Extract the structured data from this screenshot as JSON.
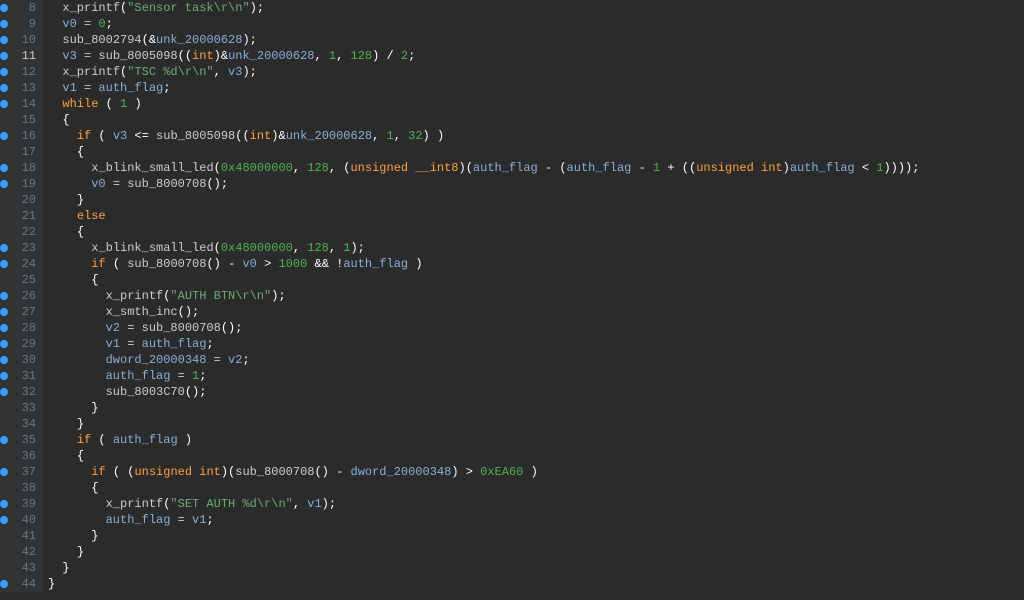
{
  "lines": [
    {
      "n": 8,
      "bp": true,
      "indent": 2,
      "tokens": [
        [
          "func",
          "x_printf"
        ],
        [
          "punc",
          "("
        ],
        [
          "string",
          "\"Sensor task\\r\\n\""
        ],
        [
          "punc",
          ");"
        ]
      ]
    },
    {
      "n": 9,
      "bp": true,
      "indent": 2,
      "tokens": [
        [
          "ident",
          "v0"
        ],
        [
          "default",
          " "
        ],
        [
          "assign",
          "="
        ],
        [
          "default",
          " "
        ],
        [
          "num",
          "0"
        ],
        [
          "punc",
          ";"
        ]
      ]
    },
    {
      "n": 10,
      "bp": true,
      "indent": 2,
      "tokens": [
        [
          "func",
          "sub_8002794"
        ],
        [
          "punc",
          "(&"
        ],
        [
          "ident",
          "unk_20000628"
        ],
        [
          "punc",
          ");"
        ]
      ]
    },
    {
      "n": 11,
      "bp": true,
      "cur": true,
      "indent": 2,
      "tokens": [
        [
          "ident",
          "v3"
        ],
        [
          "default",
          " "
        ],
        [
          "assign",
          "="
        ],
        [
          "default",
          " "
        ],
        [
          "func",
          "sub_8005098"
        ],
        [
          "punc",
          "(("
        ],
        [
          "type",
          "int"
        ],
        [
          "punc",
          ")&"
        ],
        [
          "ident",
          "unk_20000628"
        ],
        [
          "punc",
          ","
        ],
        [
          "default",
          " "
        ],
        [
          "num",
          "1"
        ],
        [
          "punc",
          ","
        ],
        [
          "default",
          " "
        ],
        [
          "num",
          "128"
        ],
        [
          "punc",
          ")"
        ],
        [
          "default",
          " "
        ],
        [
          "punc",
          "/"
        ],
        [
          "default",
          " "
        ],
        [
          "num",
          "2"
        ],
        [
          "punc",
          ";"
        ]
      ]
    },
    {
      "n": 12,
      "bp": true,
      "indent": 2,
      "tokens": [
        [
          "func",
          "x_printf"
        ],
        [
          "punc",
          "("
        ],
        [
          "string",
          "\"TSC %d\\r\\n\""
        ],
        [
          "punc",
          ","
        ],
        [
          "default",
          " "
        ],
        [
          "ident",
          "v3"
        ],
        [
          "punc",
          ");"
        ]
      ]
    },
    {
      "n": 13,
      "bp": true,
      "indent": 2,
      "tokens": [
        [
          "ident",
          "v1"
        ],
        [
          "default",
          " "
        ],
        [
          "assign",
          "="
        ],
        [
          "default",
          " "
        ],
        [
          "ident",
          "auth_flag"
        ],
        [
          "punc",
          ";"
        ]
      ]
    },
    {
      "n": 14,
      "bp": true,
      "indent": 2,
      "tokens": [
        [
          "keyword",
          "while"
        ],
        [
          "default",
          " "
        ],
        [
          "punc",
          "("
        ],
        [
          "default",
          " "
        ],
        [
          "num",
          "1"
        ],
        [
          "default",
          " "
        ],
        [
          "punc",
          ")"
        ]
      ]
    },
    {
      "n": 15,
      "bp": false,
      "indent": 2,
      "tokens": [
        [
          "punc",
          "{"
        ]
      ]
    },
    {
      "n": 16,
      "bp": true,
      "indent": 4,
      "tokens": [
        [
          "keyword",
          "if"
        ],
        [
          "default",
          " "
        ],
        [
          "punc",
          "("
        ],
        [
          "default",
          " "
        ],
        [
          "ident",
          "v3"
        ],
        [
          "default",
          " "
        ],
        [
          "punc",
          "<="
        ],
        [
          "default",
          " "
        ],
        [
          "func",
          "sub_8005098"
        ],
        [
          "punc",
          "(("
        ],
        [
          "type",
          "int"
        ],
        [
          "punc",
          ")&"
        ],
        [
          "ident",
          "unk_20000628"
        ],
        [
          "punc",
          ","
        ],
        [
          "default",
          " "
        ],
        [
          "num",
          "1"
        ],
        [
          "punc",
          ","
        ],
        [
          "default",
          " "
        ],
        [
          "num",
          "32"
        ],
        [
          "punc",
          ")"
        ],
        [
          "default",
          " "
        ],
        [
          "punc",
          ")"
        ]
      ]
    },
    {
      "n": 17,
      "bp": false,
      "indent": 4,
      "tokens": [
        [
          "punc",
          "{"
        ]
      ]
    },
    {
      "n": 18,
      "bp": true,
      "indent": 6,
      "tokens": [
        [
          "func",
          "x_blink_small_led"
        ],
        [
          "punc",
          "("
        ],
        [
          "num",
          "0x48000000"
        ],
        [
          "punc",
          ","
        ],
        [
          "default",
          " "
        ],
        [
          "num",
          "128"
        ],
        [
          "punc",
          ","
        ],
        [
          "default",
          " "
        ],
        [
          "punc",
          "("
        ],
        [
          "type",
          "unsigned __int8"
        ],
        [
          "punc",
          ")("
        ],
        [
          "ident",
          "auth_flag"
        ],
        [
          "default",
          " "
        ],
        [
          "punc",
          "-"
        ],
        [
          "default",
          " "
        ],
        [
          "punc",
          "("
        ],
        [
          "ident",
          "auth_flag"
        ],
        [
          "default",
          " "
        ],
        [
          "punc",
          "-"
        ],
        [
          "default",
          " "
        ],
        [
          "num",
          "1"
        ],
        [
          "default",
          " "
        ],
        [
          "punc",
          "+"
        ],
        [
          "default",
          " "
        ],
        [
          "punc",
          "(("
        ],
        [
          "type",
          "unsigned int"
        ],
        [
          "punc",
          ")"
        ],
        [
          "ident",
          "auth_flag"
        ],
        [
          "default",
          " "
        ],
        [
          "punc",
          "<"
        ],
        [
          "default",
          " "
        ],
        [
          "num",
          "1"
        ],
        [
          "punc",
          "))));"
        ]
      ]
    },
    {
      "n": 19,
      "bp": true,
      "indent": 6,
      "tokens": [
        [
          "ident",
          "v0"
        ],
        [
          "default",
          " "
        ],
        [
          "assign",
          "="
        ],
        [
          "default",
          " "
        ],
        [
          "func",
          "sub_8000708"
        ],
        [
          "punc",
          "();"
        ]
      ]
    },
    {
      "n": 20,
      "bp": false,
      "indent": 4,
      "tokens": [
        [
          "punc",
          "}"
        ]
      ]
    },
    {
      "n": 21,
      "bp": false,
      "indent": 4,
      "tokens": [
        [
          "keyword",
          "else"
        ]
      ]
    },
    {
      "n": 22,
      "bp": false,
      "indent": 4,
      "tokens": [
        [
          "punc",
          "{"
        ]
      ]
    },
    {
      "n": 23,
      "bp": true,
      "indent": 6,
      "tokens": [
        [
          "func",
          "x_blink_small_led"
        ],
        [
          "punc",
          "("
        ],
        [
          "num",
          "0x48000000"
        ],
        [
          "punc",
          ","
        ],
        [
          "default",
          " "
        ],
        [
          "num",
          "128"
        ],
        [
          "punc",
          ","
        ],
        [
          "default",
          " "
        ],
        [
          "num",
          "1"
        ],
        [
          "punc",
          ");"
        ]
      ]
    },
    {
      "n": 24,
      "bp": true,
      "indent": 6,
      "tokens": [
        [
          "keyword",
          "if"
        ],
        [
          "default",
          " "
        ],
        [
          "punc",
          "("
        ],
        [
          "default",
          " "
        ],
        [
          "func",
          "sub_8000708"
        ],
        [
          "punc",
          "()"
        ],
        [
          "default",
          " "
        ],
        [
          "punc",
          "-"
        ],
        [
          "default",
          " "
        ],
        [
          "ident",
          "v0"
        ],
        [
          "default",
          " "
        ],
        [
          "punc",
          ">"
        ],
        [
          "default",
          " "
        ],
        [
          "num",
          "1000"
        ],
        [
          "default",
          " "
        ],
        [
          "punc",
          "&&"
        ],
        [
          "default",
          " "
        ],
        [
          "punc",
          "!"
        ],
        [
          "ident",
          "auth_flag"
        ],
        [
          "default",
          " "
        ],
        [
          "punc",
          ")"
        ]
      ]
    },
    {
      "n": 25,
      "bp": false,
      "indent": 6,
      "tokens": [
        [
          "punc",
          "{"
        ]
      ]
    },
    {
      "n": 26,
      "bp": true,
      "indent": 8,
      "tokens": [
        [
          "func",
          "x_printf"
        ],
        [
          "punc",
          "("
        ],
        [
          "string",
          "\"AUTH BTN\\r\\n\""
        ],
        [
          "punc",
          ");"
        ]
      ]
    },
    {
      "n": 27,
      "bp": true,
      "indent": 8,
      "tokens": [
        [
          "func",
          "x_smth_inc"
        ],
        [
          "punc",
          "();"
        ]
      ]
    },
    {
      "n": 28,
      "bp": true,
      "indent": 8,
      "tokens": [
        [
          "ident",
          "v2"
        ],
        [
          "default",
          " "
        ],
        [
          "assign",
          "="
        ],
        [
          "default",
          " "
        ],
        [
          "func",
          "sub_8000708"
        ],
        [
          "punc",
          "();"
        ]
      ]
    },
    {
      "n": 29,
      "bp": true,
      "indent": 8,
      "tokens": [
        [
          "ident",
          "v1"
        ],
        [
          "default",
          " "
        ],
        [
          "assign",
          "="
        ],
        [
          "default",
          " "
        ],
        [
          "ident",
          "auth_flag"
        ],
        [
          "punc",
          ";"
        ]
      ]
    },
    {
      "n": 30,
      "bp": true,
      "indent": 8,
      "tokens": [
        [
          "ident",
          "dword_20000348"
        ],
        [
          "default",
          " "
        ],
        [
          "assign",
          "="
        ],
        [
          "default",
          " "
        ],
        [
          "ident",
          "v2"
        ],
        [
          "punc",
          ";"
        ]
      ]
    },
    {
      "n": 31,
      "bp": true,
      "indent": 8,
      "tokens": [
        [
          "ident",
          "auth_flag"
        ],
        [
          "default",
          " "
        ],
        [
          "assign",
          "="
        ],
        [
          "default",
          " "
        ],
        [
          "num",
          "1"
        ],
        [
          "punc",
          ";"
        ]
      ]
    },
    {
      "n": 32,
      "bp": true,
      "indent": 8,
      "tokens": [
        [
          "func",
          "sub_8003C70"
        ],
        [
          "punc",
          "();"
        ]
      ]
    },
    {
      "n": 33,
      "bp": false,
      "indent": 6,
      "tokens": [
        [
          "punc",
          "}"
        ]
      ]
    },
    {
      "n": 34,
      "bp": false,
      "indent": 4,
      "tokens": [
        [
          "punc",
          "}"
        ]
      ]
    },
    {
      "n": 35,
      "bp": true,
      "indent": 4,
      "tokens": [
        [
          "keyword",
          "if"
        ],
        [
          "default",
          " "
        ],
        [
          "punc",
          "("
        ],
        [
          "default",
          " "
        ],
        [
          "ident",
          "auth_flag"
        ],
        [
          "default",
          " "
        ],
        [
          "punc",
          ")"
        ]
      ]
    },
    {
      "n": 36,
      "bp": false,
      "indent": 4,
      "tokens": [
        [
          "punc",
          "{"
        ]
      ]
    },
    {
      "n": 37,
      "bp": true,
      "indent": 6,
      "tokens": [
        [
          "keyword",
          "if"
        ],
        [
          "default",
          " "
        ],
        [
          "punc",
          "("
        ],
        [
          "default",
          " "
        ],
        [
          "punc",
          "("
        ],
        [
          "type",
          "unsigned int"
        ],
        [
          "punc",
          ")("
        ],
        [
          "func",
          "sub_8000708"
        ],
        [
          "punc",
          "()"
        ],
        [
          "default",
          " "
        ],
        [
          "punc",
          "-"
        ],
        [
          "default",
          " "
        ],
        [
          "ident",
          "dword_20000348"
        ],
        [
          "punc",
          ")"
        ],
        [
          "default",
          " "
        ],
        [
          "punc",
          ">"
        ],
        [
          "default",
          " "
        ],
        [
          "num",
          "0xEA60"
        ],
        [
          "default",
          " "
        ],
        [
          "punc",
          ")"
        ]
      ]
    },
    {
      "n": 38,
      "bp": false,
      "indent": 6,
      "tokens": [
        [
          "punc",
          "{"
        ]
      ]
    },
    {
      "n": 39,
      "bp": true,
      "indent": 8,
      "tokens": [
        [
          "func",
          "x_printf"
        ],
        [
          "punc",
          "("
        ],
        [
          "string",
          "\"SET AUTH %d\\r\\n\""
        ],
        [
          "punc",
          ","
        ],
        [
          "default",
          " "
        ],
        [
          "ident",
          "v1"
        ],
        [
          "punc",
          ");"
        ]
      ]
    },
    {
      "n": 40,
      "bp": true,
      "indent": 8,
      "tokens": [
        [
          "ident",
          "auth_flag"
        ],
        [
          "default",
          " "
        ],
        [
          "assign",
          "="
        ],
        [
          "default",
          " "
        ],
        [
          "ident",
          "v1"
        ],
        [
          "punc",
          ";"
        ]
      ]
    },
    {
      "n": 41,
      "bp": false,
      "indent": 6,
      "tokens": [
        [
          "punc",
          "}"
        ]
      ]
    },
    {
      "n": 42,
      "bp": false,
      "indent": 4,
      "tokens": [
        [
          "punc",
          "}"
        ]
      ]
    },
    {
      "n": 43,
      "bp": false,
      "indent": 2,
      "tokens": [
        [
          "punc",
          "}"
        ]
      ]
    },
    {
      "n": 44,
      "bp": true,
      "indent": 0,
      "tokens": [
        [
          "punc",
          "}"
        ]
      ]
    }
  ]
}
